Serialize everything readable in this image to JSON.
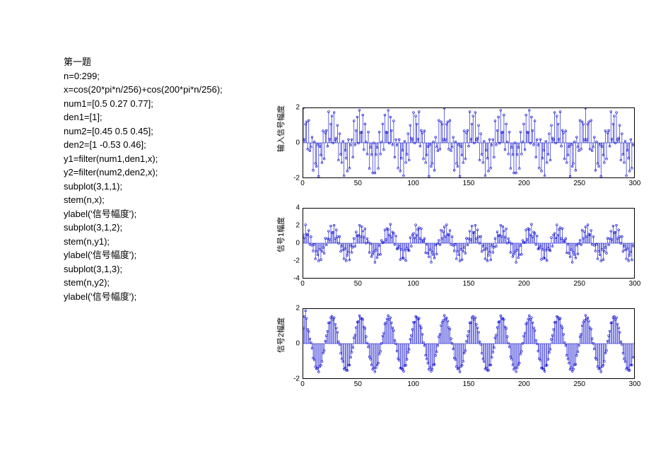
{
  "code": {
    "title": "第一题",
    "lines": [
      "n=0:299;",
      "x=cos(20*pi*n/256)+cos(200*pi*n/256);",
      "num1=[0.5 0.27 0.77];",
      "den1=[1];",
      "num2=[0.45 0.5 0.45];",
      "den2=[1 -0.53 0.46];",
      "y1=filter(num1,den1,x);",
      "y2=filter(num2,den2,x);",
      "subplot(3,1,1);",
      "stem(n,x);",
      "ylabel('信号幅度');",
      "subplot(3,1,2);",
      "stem(n,y1);",
      "ylabel('信号幅度');",
      "subplot(3,1,3);",
      "stem(n,y2);",
      "ylabel('信号幅度');"
    ]
  },
  "chart_data": [
    {
      "type": "stem",
      "ylabel": "输入信号幅度",
      "xlim": [
        0,
        300
      ],
      "ylim": [
        -2,
        2
      ],
      "xticks": [
        0,
        50,
        100,
        150,
        200,
        250,
        300
      ],
      "yticks": [
        -2,
        0,
        2
      ],
      "n_points": 300,
      "formula": "cos(20*pi*n/256)+cos(200*pi*n/256)"
    },
    {
      "type": "stem",
      "ylabel": "信号1幅度",
      "xlim": [
        0,
        300
      ],
      "ylim": [
        -4,
        4
      ],
      "xticks": [
        0,
        50,
        100,
        150,
        200,
        250,
        300
      ],
      "yticks": [
        -4,
        -2,
        0,
        2,
        4
      ],
      "n_points": 300,
      "formula": "filter([0.5 0.27 0.77],[1],x)"
    },
    {
      "type": "stem",
      "ylabel": "信号2幅度",
      "xlim": [
        0,
        300
      ],
      "ylim": [
        -2,
        2
      ],
      "xticks": [
        0,
        50,
        100,
        150,
        200,
        250,
        300
      ],
      "yticks": [
        -2,
        0,
        2
      ],
      "n_points": 300,
      "formula": "filter([0.45 0.5 0.45],[1 -0.53 0.46],x)"
    }
  ]
}
